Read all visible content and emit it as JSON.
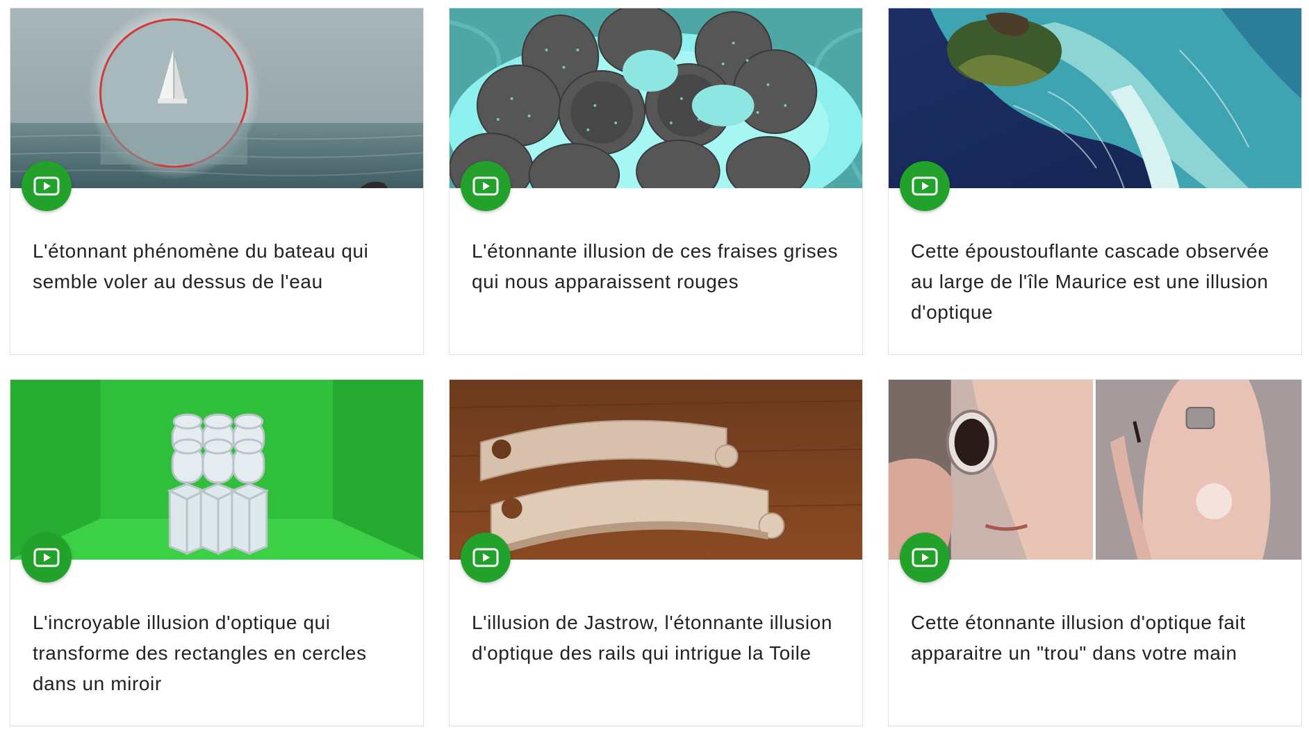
{
  "accent_color": "#22a22a",
  "cards": [
    {
      "title": "L'étonnant phénomène du bateau qui semble voler au dessus de l'eau",
      "badge_icon": "video-play-icon",
      "image": "sailboat-over-sea-photo"
    },
    {
      "title": "L'étonnante illusion de ces fraises grises qui nous apparaissent rouges",
      "badge_icon": "video-play-icon",
      "image": "grey-strawberries-photo"
    },
    {
      "title": "Cette époustouflante cascade observée au large de l'île Maurice est une illusion d'optique",
      "badge_icon": "video-play-icon",
      "image": "mauritius-underwater-waterfall-photo"
    },
    {
      "title": "L'incroyable illusion d'optique qui transforme des rectangles en cercles dans un miroir",
      "badge_icon": "video-play-icon",
      "image": "rectangles-circles-mirror-photo"
    },
    {
      "title": "L'illusion de Jastrow, l'étonnante illusion d'optique des rails qui intrigue la Toile",
      "badge_icon": "video-play-icon",
      "image": "jastrow-wooden-rails-photo"
    },
    {
      "title": "Cette étonnante illusion d'optique fait apparaitre un \"trou\" dans votre main",
      "badge_icon": "video-play-icon",
      "image": "hole-in-hand-photo"
    }
  ]
}
